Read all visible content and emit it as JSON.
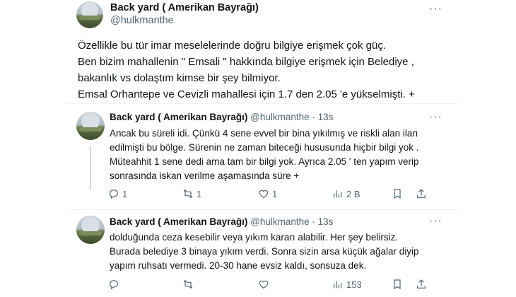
{
  "main_post": {
    "author_name": "Back yard ( Amerikan Bayrağı)",
    "author_handle": "@hulkmanthe",
    "more_label": "···",
    "lines": [
      "Özellikle bu tür imar meselelerinde doğru bilgiye erişmek çok güç.",
      "Ben bizim mahallenin \" Emsali \" hakkında bilgiye erişmek için Belediye ,",
      "bakanlık vs dolaştım kimse bir şey bilmiyor.",
      "Emsal Orhantepe ve Cevizli mahallesi için 1.7 den 2.05 'e yükselmişti. +"
    ]
  },
  "replies": [
    {
      "author_name": "Back yard ( Amerikan Bayrağı)",
      "author_handle": "@hulkmanthe",
      "time": "· 13s",
      "more_label": "···",
      "lines": [
        "Ancak bu süreli idi. Çünkü 4 sene evvel bir bina yıkılmış ve riskli alan ilan",
        "edilmişti bu bölge. Sürenin ne zaman biteceği hususunda hiçbir bilgi yok .",
        "Müteahhit 1 sene dedi ama tam bir bilgi yok. Ayrıca 2.05 ' ten yapım verip",
        "sonrasında iskan verilme aşamasında süre +"
      ],
      "actions": {
        "replies": "1",
        "reposts": "1",
        "likes": "1",
        "views": "2 B"
      }
    },
    {
      "author_name": "Back yard ( Amerikan Bayrağı)",
      "author_handle": "@hulkmanthe",
      "time": "· 13s",
      "more_label": "···",
      "lines": [
        "dolduğunda ceza kesebilir veya yıkım kararı alabilir. Her şey belirsiz.",
        "Burada belediye 3 binaya yıkım verdi. Sonra sizin arsa küçük ağalar diyip",
        "yapım ruhsatı vermedi. 20-30 hane evsiz kaldı, sonsuza dek."
      ],
      "actions": {
        "replies": "",
        "reposts": "",
        "likes": "",
        "views": "153"
      }
    }
  ],
  "icons": {
    "reply": "reply-icon",
    "repost": "repost-icon",
    "like": "heart-icon",
    "views": "views-icon",
    "bookmark": "bookmark-icon",
    "share": "share-icon"
  },
  "colors": {
    "text": "#0f1419",
    "secondary": "#536471",
    "divider": "#eff3f4"
  }
}
